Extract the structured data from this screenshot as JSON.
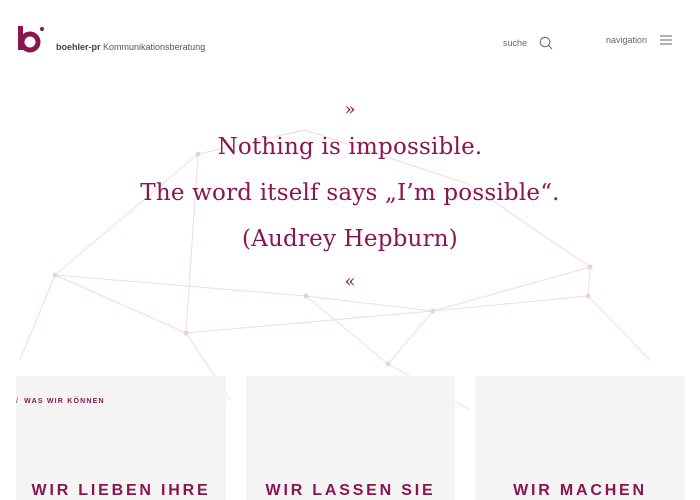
{
  "header": {
    "brand_name": "boehler-pr",
    "brand_tagline": "Kommunikationsberatung",
    "search_label": "suche",
    "nav_label": "navigation"
  },
  "quote": {
    "open_mark": "»",
    "lines": [
      "Nothing is impossible.",
      "The word itself says „I’m possible“.",
      "(Audrey Hepburn)"
    ],
    "close_mark": "«"
  },
  "section": {
    "eyebrow": "WAS WIR KÖNNEN"
  },
  "cards": [
    {
      "title": "WIR LIEBEN IHRE"
    },
    {
      "title": "WIR LASSEN SIE"
    },
    {
      "title": "WIR MACHEN"
    }
  ],
  "colors": {
    "accent": "#8a1550",
    "card_bg": "#f4f4f4",
    "text_gray": "#666666"
  }
}
